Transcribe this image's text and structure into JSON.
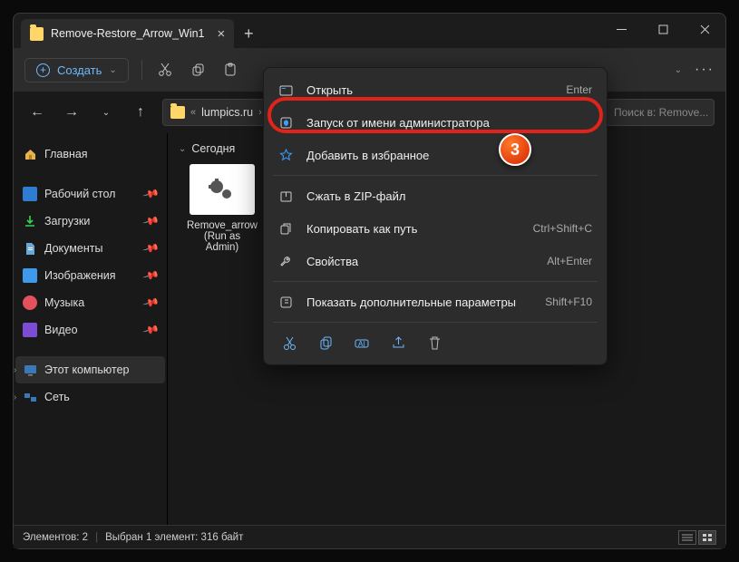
{
  "tab": {
    "title": "Remove-Restore_Arrow_Win1"
  },
  "toolbar": {
    "create": "Создать"
  },
  "breadcrumb": {
    "seg1": "lumpics.ru",
    "chev": "«"
  },
  "search": {
    "placeholder": "Поиск в: Remove..."
  },
  "sidebar": {
    "home": "Главная",
    "desktop": "Рабочий стол",
    "downloads": "Загрузки",
    "documents": "Документы",
    "images": "Изображения",
    "music": "Музыка",
    "video": "Видео",
    "thispc": "Этот компьютер",
    "network": "Сеть"
  },
  "content": {
    "group": "Сегодня",
    "file_line1": "Remove_arrow",
    "file_line2": "(Run as",
    "file_line3": "Admin)"
  },
  "ctx": {
    "open": "Открыть",
    "open_short": "Enter",
    "runas": "Запуск от имени администратора",
    "fav": "Добавить в избранное",
    "zip": "Сжать в ZIP-файл",
    "copypath": "Копировать как путь",
    "copypath_short": "Ctrl+Shift+C",
    "props": "Свойства",
    "props_short": "Alt+Enter",
    "more": "Показать дополнительные параметры",
    "more_short": "Shift+F10"
  },
  "badge": "3",
  "status": {
    "count": "Элементов: 2",
    "sel": "Выбран 1 элемент: 316 байт"
  }
}
